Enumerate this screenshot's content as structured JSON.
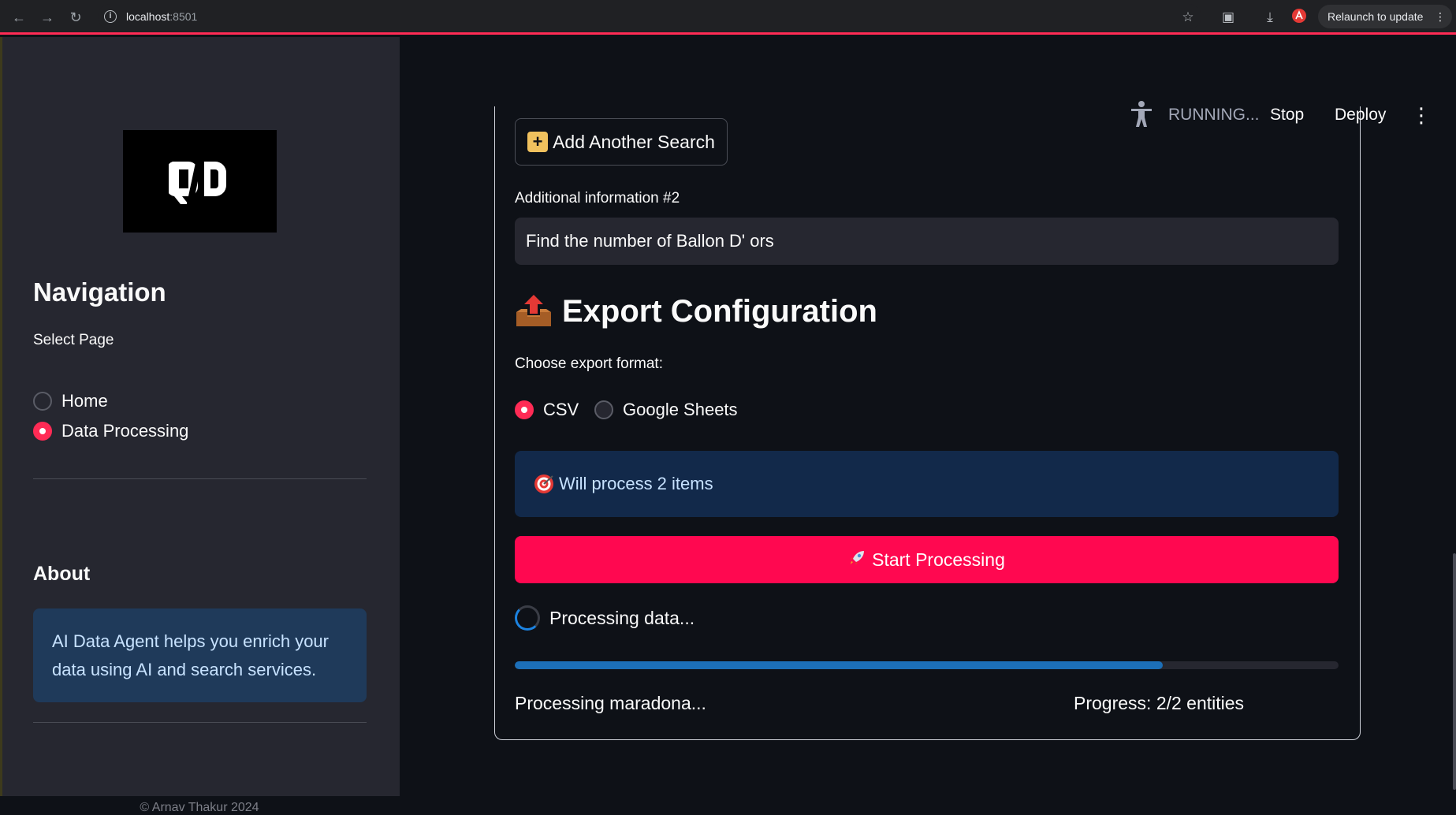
{
  "browser": {
    "url_host": "localhost",
    "url_port": ":8501",
    "relaunch_label": "Relaunch to update"
  },
  "sidebar": {
    "logo_text": "QD",
    "nav_title": "Navigation",
    "select_label": "Select Page",
    "pages": [
      {
        "label": "Home",
        "selected": false
      },
      {
        "label": "Data Processing",
        "selected": true
      }
    ],
    "about_title": "About",
    "about_text": "AI Data Agent helps you enrich your data using AI and search services.",
    "copyright": "© Arnav Thakur 2024"
  },
  "toolbar": {
    "status": "RUNNING...",
    "stop_label": "Stop",
    "deploy_label": "Deploy"
  },
  "main": {
    "add_search_label": "Add Another Search",
    "additional_info_label": "Additional information #2",
    "additional_info_value": "Find the number of Ballon D' ors",
    "export_title": "Export Configuration",
    "choose_format_label": "Choose export format:",
    "formats": [
      {
        "label": "CSV",
        "selected": true
      },
      {
        "label": "Google Sheets",
        "selected": false
      }
    ],
    "info_message": "Will process 2 items",
    "start_button_label": "Start Processing",
    "spinner_text": "Processing data...",
    "progress_fraction": 0.787,
    "status_text": "Processing maradona...",
    "progress_text": "Progress: 2/2 entities"
  },
  "colors": {
    "accent": "#ff2b55",
    "primary_button": "#ff0850",
    "info_bg": "#12294a",
    "progress": "#1c6fb8"
  }
}
